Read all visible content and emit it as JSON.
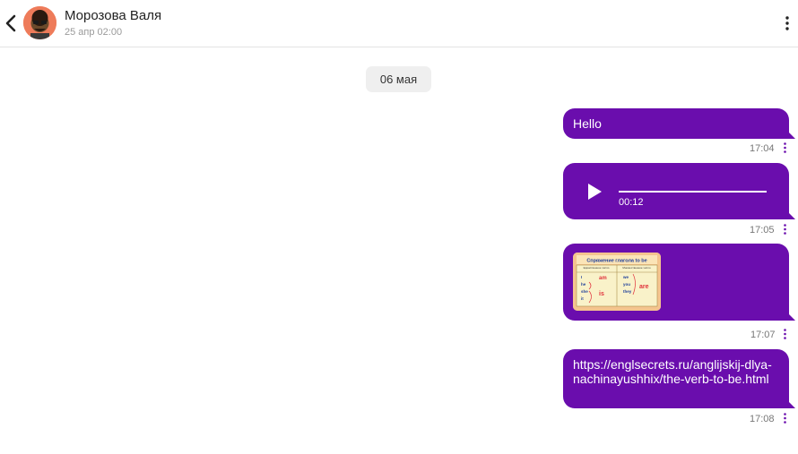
{
  "header": {
    "contact_name": "Морозова Валя",
    "last_seen": "25 апр 02:00",
    "icons": {
      "back": "chevron-left-icon",
      "menu": "kebab-menu-icon"
    }
  },
  "chat": {
    "date_separator": "06 мая",
    "messages": [
      {
        "type": "text",
        "text": "Hello",
        "time": "17:04"
      },
      {
        "type": "audio",
        "duration": "00:12",
        "progress": 0,
        "time": "17:05"
      },
      {
        "type": "image",
        "image": {
          "title": "Спряжение глагола to be",
          "table_headers": [
            "Единственное число",
            "Множественное число"
          ],
          "singular_pronouns": [
            "I",
            "he",
            "she",
            "it"
          ],
          "singular_verbs": [
            "am",
            "is"
          ],
          "plural_pronouns": [
            "we",
            "you",
            "they"
          ],
          "plural_verb": "are"
        },
        "time": "17:07"
      },
      {
        "type": "link",
        "text": "https://englsecrets.ru/anglijskij-dlya-nachinayushhix/the-verb-to-be.html",
        "time": "17:08"
      }
    ]
  },
  "colors": {
    "bubble": "#6a0dad",
    "menu_dots": "#6a0dad",
    "time_text": "#777777",
    "date_chip_bg": "#efefef",
    "avatar_bg": "#ee7b5a"
  }
}
